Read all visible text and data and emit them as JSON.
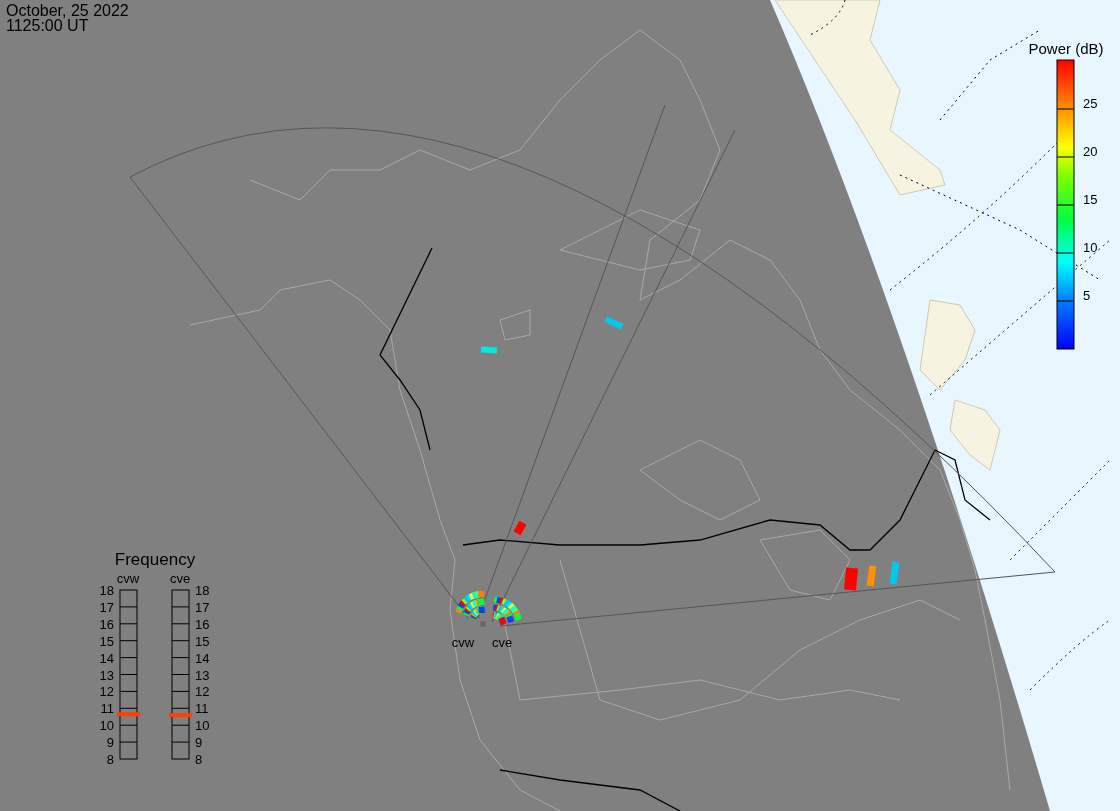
{
  "timestamp": {
    "date": "October, 25 2022",
    "time": "1125:00 UT"
  },
  "power_scale": {
    "title": "Power (dB)",
    "ticks": [
      "25",
      "20",
      "15",
      "10",
      "5"
    ]
  },
  "frequency_panel": {
    "title": "Frequency",
    "radars": [
      {
        "name": "cvw",
        "kind": "left",
        "level": 0.265,
        "ticks": [
          "18",
          "17",
          "16",
          "15",
          "14",
          "13",
          "12",
          "11",
          "10",
          "9",
          "8"
        ]
      },
      {
        "name": "cve",
        "kind": "right",
        "level": 0.26,
        "ticks": [
          "18",
          "17",
          "16",
          "15",
          "14",
          "13",
          "12",
          "11",
          "10",
          "9",
          "8"
        ]
      }
    ]
  },
  "map": {
    "radar_sites": [
      {
        "label": "cvw"
      },
      {
        "label": "cve"
      }
    ]
  }
}
